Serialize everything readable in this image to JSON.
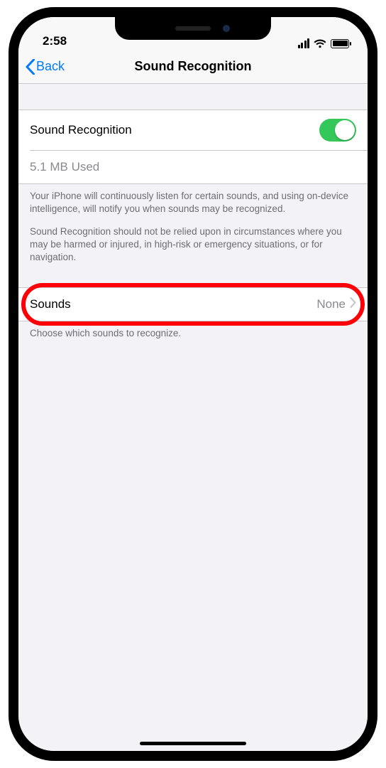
{
  "status": {
    "time": "2:58"
  },
  "nav": {
    "back_label": "Back",
    "title": "Sound Recognition"
  },
  "toggle_row": {
    "label": "Sound Recognition",
    "on": true
  },
  "storage_row": {
    "label": "5.1 MB Used"
  },
  "description": {
    "p1": "Your iPhone will continuously listen for certain sounds, and using on-device intelligence, will notify you when sounds may be recognized.",
    "p2": "Sound Recognition should not be relied upon in circumstances where you may be harmed or injured, in high-risk or emergency situations, or for navigation."
  },
  "sounds_row": {
    "label": "Sounds",
    "value": "None"
  },
  "sounds_footer": "Choose which sounds to recognize."
}
